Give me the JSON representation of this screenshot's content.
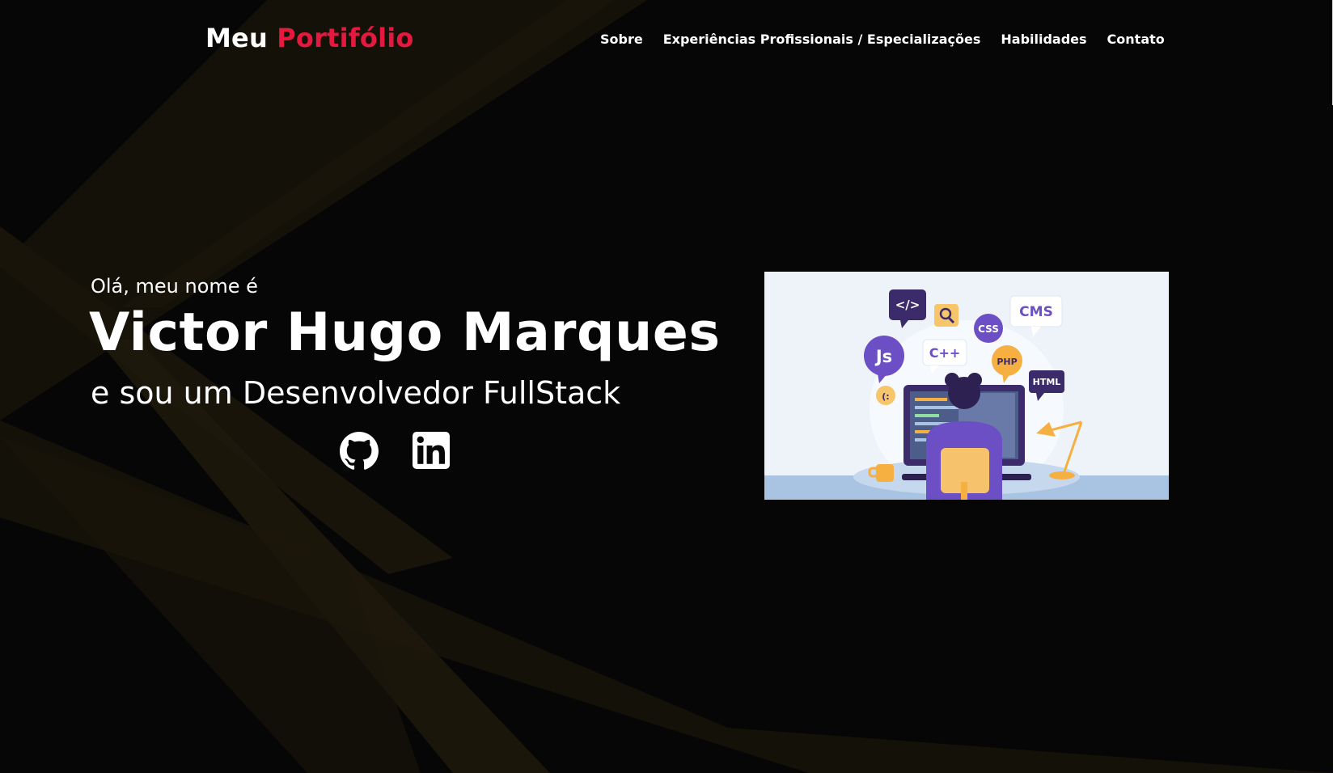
{
  "header": {
    "logo_part1": "Meu",
    "logo_part2": "Portifólio",
    "nav": [
      {
        "label": "Sobre"
      },
      {
        "label": "Experiências Profissionais / Especializações"
      },
      {
        "label": "Habilidades"
      },
      {
        "label": "Contato"
      }
    ]
  },
  "hero": {
    "greeting": "Olá, meu nome é",
    "name": "Victor Hugo Marques",
    "role": "e sou um Desenvolvedor FullStack",
    "social": [
      {
        "icon": "github-icon"
      },
      {
        "icon": "linkedin-icon"
      }
    ],
    "illustration": {
      "bubbles": {
        "code": "</>",
        "cms": "CMS",
        "css": "CSS",
        "js": "Js",
        "cpp": "C++",
        "php": "PHP",
        "html": "HTML",
        "smile": "(:"
      }
    }
  },
  "colors": {
    "accent": "#e5193f",
    "background": "#060606",
    "illustration_purple": "#6c4fc4",
    "illustration_orange": "#f6b042"
  }
}
